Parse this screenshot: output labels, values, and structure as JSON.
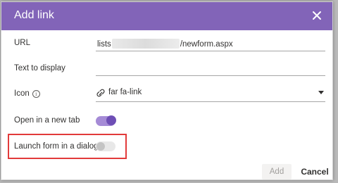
{
  "dialog": {
    "title": "Add link",
    "close_icon": "close-icon"
  },
  "fields": {
    "url": {
      "label": "URL",
      "value_prefix": "lists",
      "value_suffix": "/newform.aspx"
    },
    "display_text": {
      "label": "Text to display",
      "value": ""
    },
    "icon": {
      "label": "Icon",
      "info_glyph": "i",
      "value": "far fa-link",
      "icon": "link-icon"
    },
    "open_new_tab": {
      "label": "Open in a new tab",
      "checked": true
    },
    "launch_dialog": {
      "label": "Launch form in a dialog",
      "checked": false
    }
  },
  "footer": {
    "add_label": "Add",
    "cancel_label": "Cancel"
  },
  "colors": {
    "titlebar": "#8264b8",
    "toggle_on": "#6e4eb5",
    "highlight_box": "#e23a3a"
  }
}
